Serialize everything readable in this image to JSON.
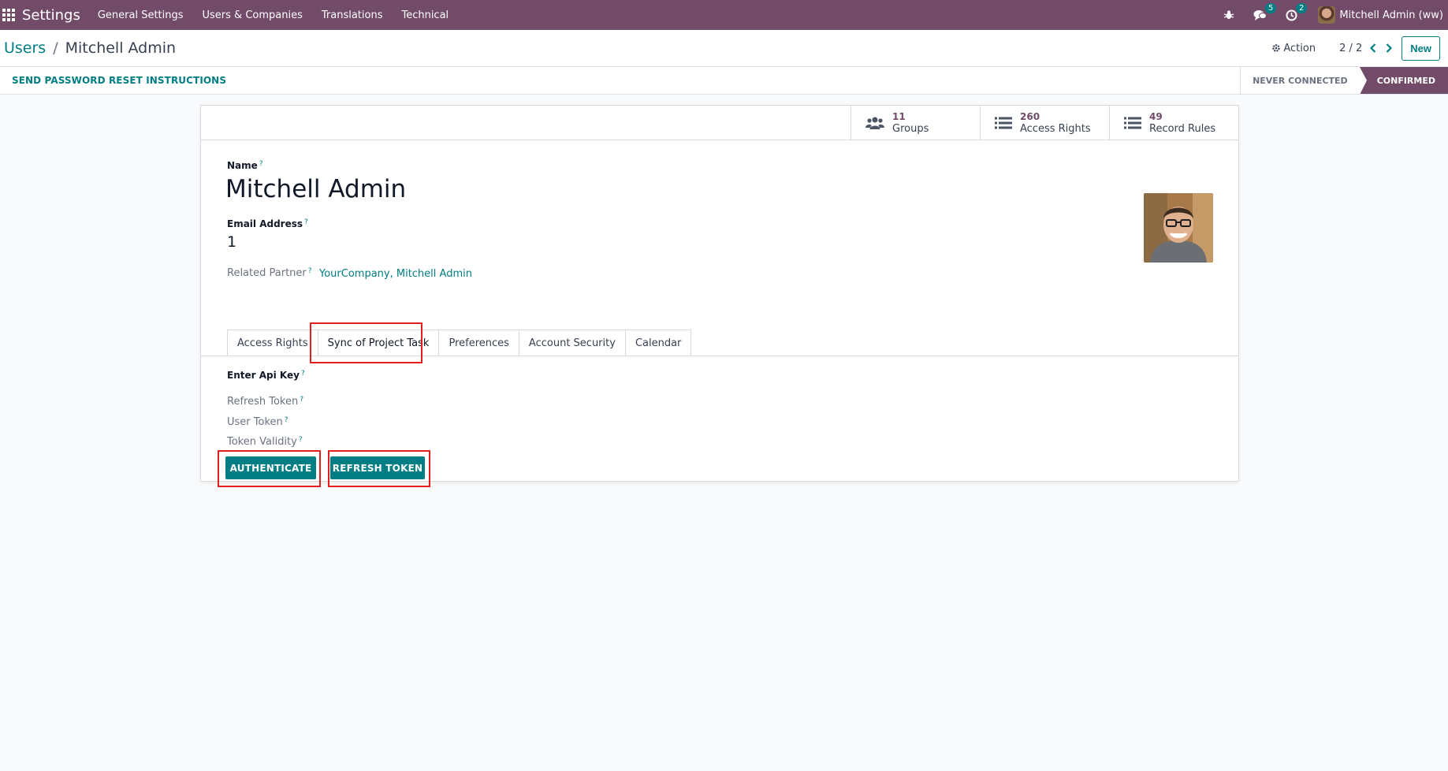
{
  "navbar": {
    "brand": "Settings",
    "menu": [
      "General Settings",
      "Users & Companies",
      "Translations",
      "Technical"
    ],
    "messages_badge": "5",
    "activity_badge": "2",
    "user_name": "Mitchell Admin (ww)",
    "bar_color": "#714b67"
  },
  "control_panel": {
    "breadcrumb_parent": "Users",
    "breadcrumb_sep": "/",
    "breadcrumb_current": "Mitchell Admin",
    "action_label": "Action",
    "pager": "2 / 2",
    "new_label": "New"
  },
  "statusbar": {
    "reset_label": "SEND PASSWORD RESET INSTRUCTIONS",
    "stages": [
      "NEVER CONNECTED",
      "CONFIRMED"
    ],
    "active_stage": "CONFIRMED"
  },
  "smart_buttons": [
    {
      "value": "11",
      "label": "Groups",
      "icon": "users-icon"
    },
    {
      "value": "260",
      "label": "Access Rights",
      "icon": "list-icon"
    },
    {
      "value": "49",
      "label": "Record Rules",
      "icon": "list-icon"
    }
  ],
  "form": {
    "name_label": "Name",
    "name_value": "Mitchell Admin",
    "email_label": "Email Address",
    "email_value": "1",
    "partner_label": "Related Partner",
    "partner_value": "YourCompany, Mitchell Admin",
    "help_mark": "?"
  },
  "tabs": [
    "Access Rights",
    "Sync of Project Task",
    "Preferences",
    "Account Security",
    "Calendar"
  ],
  "active_tab": "Sync of Project Task",
  "sync_tab": {
    "section_label": "Enter Api Key",
    "fields": [
      "Refresh Token",
      "User Token",
      "Token Validity"
    ],
    "authenticate_label": "AUTHENTICATE",
    "refresh_label": "REFRESH TOKEN"
  },
  "colors": {
    "primary": "#017e84",
    "brand": "#714b67",
    "highlight": "#e02020"
  }
}
